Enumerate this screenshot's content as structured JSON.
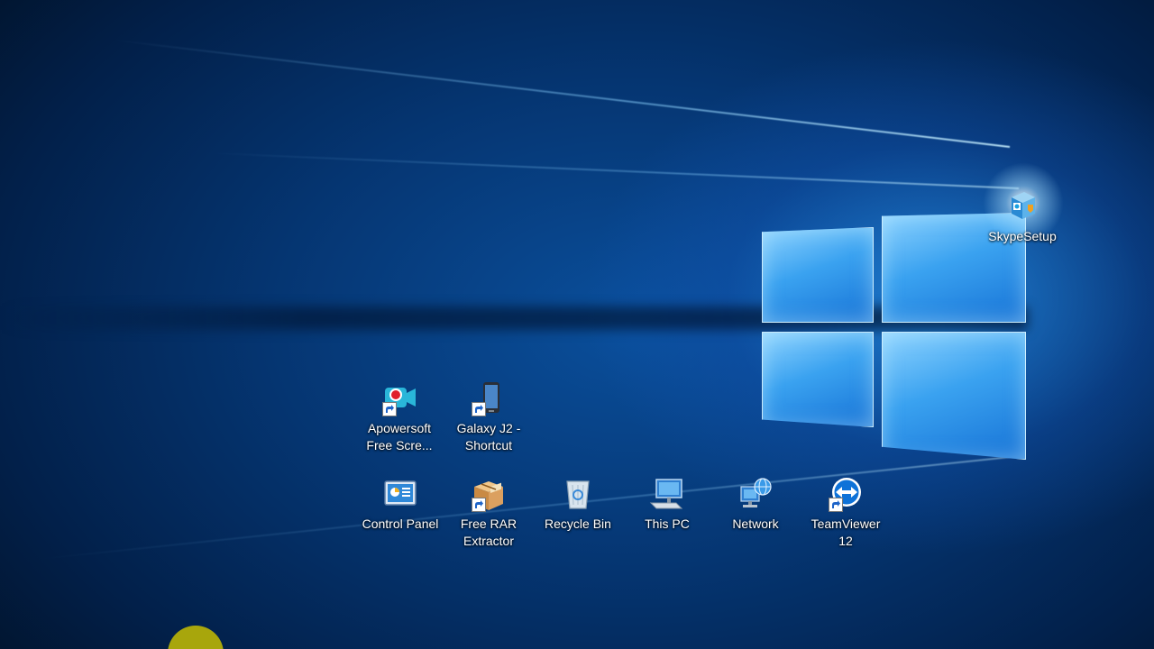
{
  "desktop": {
    "icons": [
      {
        "label": "Apowersoft\nFree Scre...",
        "icon": "apowersoft-recorder-icon",
        "shortcut": true
      },
      {
        "label": "Galaxy J2 -\nShortcut",
        "icon": "phone-icon",
        "shortcut": true
      },
      {
        "label": "Control Panel",
        "icon": "control-panel-icon",
        "shortcut": false
      },
      {
        "label": "Free RAR\nExtractor",
        "icon": "rar-box-icon",
        "shortcut": true
      },
      {
        "label": "Recycle Bin",
        "icon": "recycle-bin-icon",
        "shortcut": false
      },
      {
        "label": "This PC",
        "icon": "computer-icon",
        "shortcut": false
      },
      {
        "label": "Network",
        "icon": "network-icon",
        "shortcut": false
      },
      {
        "label": "TeamViewer\n12",
        "icon": "teamviewer-icon",
        "shortcut": true
      },
      {
        "label": "SkypeSetup",
        "icon": "installer-box-icon",
        "shortcut": false
      }
    ]
  },
  "colors": {
    "wallpaper_dark": "#01214a",
    "wallpaper_glow": "#3aa2f0",
    "cursor_highlight": "#a8a60c"
  }
}
